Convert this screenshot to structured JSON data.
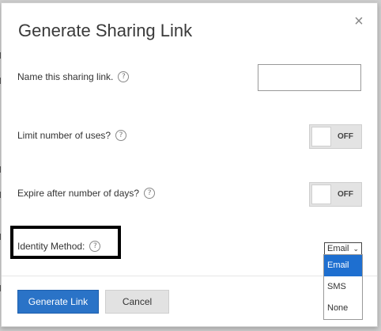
{
  "dialog": {
    "title": "Generate Sharing Link",
    "close_label": "×",
    "help_glyph": "?",
    "name_label": "Name this sharing link.",
    "name_value": "",
    "limit_label": "Limit number of uses?",
    "limit_toggle": "OFF",
    "expire_label": "Expire after number of days?",
    "expire_toggle": "OFF",
    "identity_label": "Identity Method:",
    "identity_selected": "Email",
    "identity_options": [
      "Email",
      "SMS",
      "None"
    ],
    "generate_button": "Generate Link",
    "cancel_button": "Cancel"
  },
  "icons": {
    "help": "help-circle-icon",
    "close": "close-icon",
    "chevron": "chevron-down-icon"
  },
  "colors": {
    "primary": "#2a73c7",
    "selected_option": "#1e6fd0",
    "toggle_bg": "#e3e3e3"
  }
}
